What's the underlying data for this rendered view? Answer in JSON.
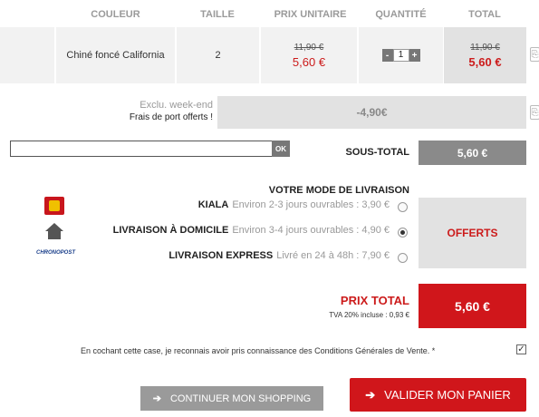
{
  "header": {
    "couleur": "COULEUR",
    "taille": "TAILLE",
    "prix_unitaire": "PRIX UNITAIRE",
    "quantite": "QUANTITÉ",
    "total": "TOTAL"
  },
  "item": {
    "color": "Chiné foncé California",
    "size": "2",
    "unit_old": "11,90 €",
    "unit_new": "5,60 €",
    "qty": "1",
    "minus": "-",
    "plus": "+",
    "total_old": "11,90 €",
    "total_new": "5,60 €"
  },
  "discount": {
    "label": "Exclu. week-end",
    "sub": "Frais de port offerts !",
    "value": "-4,90€"
  },
  "promo": {
    "value": "",
    "ok": "OK"
  },
  "subtotal": {
    "label": "SOUS-TOTAL",
    "value": "5,60 €"
  },
  "delivery": {
    "title": "VOTRE MODE DE LIVRAISON",
    "options": [
      {
        "name": "KIALA",
        "desc": "Environ 2-3 jours ouvrables : 3,90 €",
        "icon": "kiala-logo-icon",
        "selected": false
      },
      {
        "name": "LIVRAISON À DOMICILE",
        "desc": "Environ 3-4 jours ouvrables : 4,90 €",
        "icon": "home-icon",
        "selected": true
      },
      {
        "name": "LIVRAISON EXPRESS",
        "desc": "Livré en 24 à 48h : 7,90 €",
        "icon": "chronopost-logo-icon",
        "selected": false
      }
    ],
    "offerts": "OFFERTS",
    "chronopost": "CHRONOPOST"
  },
  "total": {
    "label": "PRIX TOTAL",
    "tva": "TVA 20% incluse : 0,93 €",
    "value": "5,60 €"
  },
  "cgv": {
    "text": "En cochant cette case, je reconnais avoir pris connaissance des Conditions Générales de Vente. *",
    "checked": true
  },
  "buttons": {
    "continue": "CONTINUER MON SHOPPING",
    "validate": "VALIDER MON PANIER"
  },
  "colors": {
    "accent": "#d0161b",
    "grey": "#9a9a9a"
  }
}
